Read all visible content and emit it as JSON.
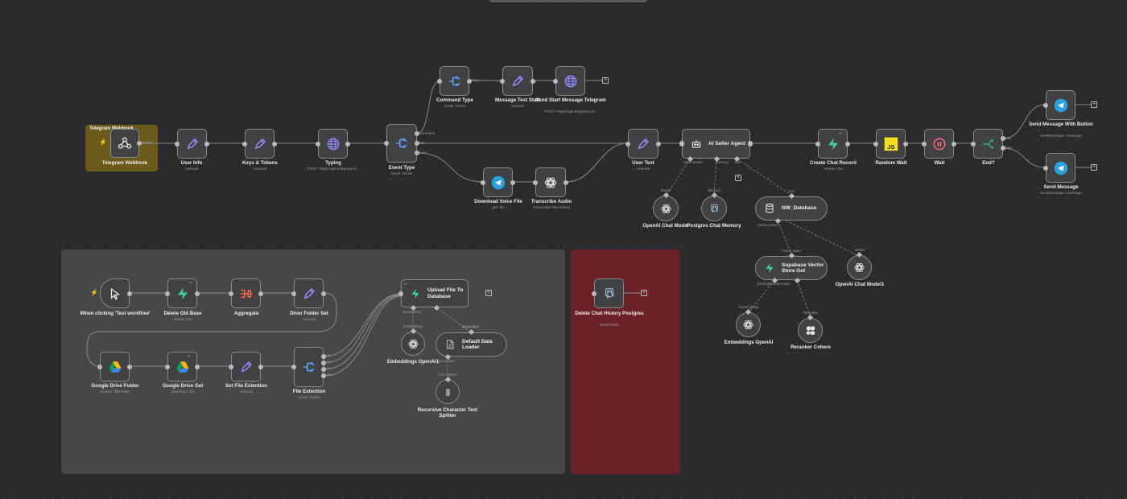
{
  "sticky": {
    "telegram_webhook_title": "Telegram Webhook",
    "colors": {
      "yellow": "#6b5a1a",
      "gray": "#464747",
      "red": "#6a2226"
    }
  },
  "nodes": {
    "telegram_webhook": {
      "label": "Telegram Webhook",
      "port": "POST"
    },
    "user_info": {
      "label": "User Info",
      "sub": "manual"
    },
    "keys_tokens": {
      "label": "Keys & Tokens",
      "sub": "manual"
    },
    "typing": {
      "label": "Typing",
      "sub": "POST: https://api.telegram.or..."
    },
    "event_type": {
      "label": "Event Type",
      "sub": "mode: Rules",
      "ports": [
        "command",
        "text",
        "voice"
      ]
    },
    "command_type": {
      "label": "Command Type",
      "sub": "mode: Rules",
      "port": "start"
    },
    "message_text_start": {
      "label": "Message Text Start",
      "sub": "manual"
    },
    "send_start_message": {
      "label": "Send Start Message Telegram",
      "sub": "POST: https://api.telegram.or..."
    },
    "download_voice": {
      "label": "Download Voice File",
      "sub": "get: file"
    },
    "transcribe_audio": {
      "label": "Transcribe Audio",
      "sub": "Transcribe Recording"
    },
    "user_text": {
      "label": "User Text",
      "sub": "manual"
    },
    "ai_seller_agent": {
      "label": "AI Seller Agent",
      "handles": [
        "Chat Model*",
        "Memory",
        "Tool"
      ]
    },
    "create_chat_record": {
      "label": "Create Chat Record",
      "sub": "create: row"
    },
    "random_wait": {
      "label": "Random Wait"
    },
    "wait": {
      "label": "Wait"
    },
    "end": {
      "label": "End?",
      "ports": [
        "true",
        "false"
      ]
    },
    "send_message_button": {
      "label": "Send Message With Button",
      "sub": "sendMessage: message"
    },
    "send_message": {
      "label": "Send Message",
      "sub": "sendMessage: message"
    },
    "openai_chat_model": {
      "label": "OpenAI Chat Model",
      "top": "Model"
    },
    "postgres_memory": {
      "label": "Postgres Chat Memory",
      "top": "Memory"
    },
    "nw_database": {
      "label": "NW_Database",
      "top": "Tool",
      "handle": "Vector Store*"
    },
    "supabase_vector": {
      "label": "Supabase Vector Store Get",
      "top": "Vector Store",
      "handles": [
        "Embedding",
        "Reranker"
      ]
    },
    "openai_chat_model1": {
      "label": "OpenAI Chat Model1",
      "top": "Model"
    },
    "embeddings_openai": {
      "label": "Embeddings OpenAI",
      "top": "Embeddings"
    },
    "reranker_cohere": {
      "label": "Reranker Cohere",
      "top": "Reranker"
    },
    "manual_trigger": {
      "label": "When clicking 'Test workflow'"
    },
    "delete_old_base": {
      "label": "Delete Old Base",
      "sub": "delete: row"
    },
    "aggregate": {
      "label": "Aggregate"
    },
    "diver_folder_set": {
      "label": "Diver Folder Set",
      "sub": "manual"
    },
    "google_drive_folder": {
      "label": "Google Drive Folder",
      "sub": "search: fileFolder"
    },
    "google_drive_get": {
      "label": "Google Drive Get",
      "sub": "download: file"
    },
    "set_file_extention": {
      "label": "Set File Extention",
      "sub": "manual"
    },
    "file_extention": {
      "label": "File Extention",
      "sub": "mode: Rules",
      "ports": [
        "pdf",
        "doc",
        "txt",
        "other"
      ]
    },
    "upload_file": {
      "label": "Upload File To Database",
      "handles": [
        "Embedding*",
        "Document*"
      ]
    },
    "embeddings_openai1": {
      "label": "Embeddings OpenAI1",
      "top": "Embeddings"
    },
    "default_data_loader": {
      "label": "Default Data Loader",
      "top": "Document",
      "handle": "Text Splitter*"
    },
    "recursive_splitter": {
      "label": "Recursive Character Text Splitter",
      "top": "Text Splitter"
    },
    "delete_chat_history": {
      "label": "Delete Chat History Postgres",
      "sub": "deleteTable"
    }
  },
  "icons": {
    "webhook": "webhook-icon",
    "pencil": "pencil-icon",
    "globe": "globe-icon",
    "switch": "switch-icon",
    "telegram": "telegram-icon",
    "openai": "openai-icon",
    "robot": "robot-icon",
    "supabase": "supabase-icon",
    "js": "javascript-icon",
    "pause": "pause-icon",
    "if": "if-icon",
    "postgres": "postgres-icon",
    "database": "database-icon",
    "cohere": "cohere-icon",
    "cursor": "cursor-icon",
    "aggregate": "aggregate-icon",
    "gdrive": "google-drive-icon",
    "document": "document-icon"
  },
  "colors": {
    "telegram": "#2aa1e0",
    "supabase": "#3ecf8e",
    "js": "#f7df1e",
    "aggregate": "#ff6a4d",
    "pause": "#ff6d7a",
    "switch": "#5ca5ff",
    "pencil": "#9c88ff",
    "globe": "#8e8bff",
    "if": "#35b07e"
  }
}
